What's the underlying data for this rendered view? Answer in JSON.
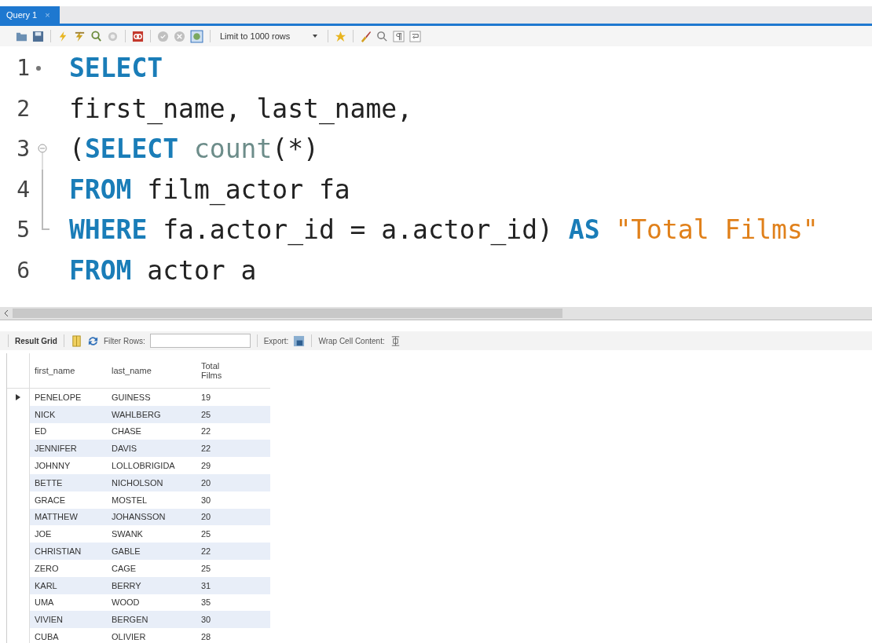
{
  "tabs": [
    {
      "label": "Query 1",
      "close": "×",
      "selected": true
    }
  ],
  "toolbar": {
    "limit_select": "Limit to 1000 rows"
  },
  "editor": {
    "lines": [
      {
        "number": "1",
        "current_line": true,
        "tokens": [
          {
            "kind": "keyword",
            "text": "SELECT"
          }
        ]
      },
      {
        "number": "2",
        "tokens": [
          {
            "kind": "plain",
            "text": "first_name, last_name,"
          }
        ]
      },
      {
        "number": "3",
        "fold_start": true,
        "tokens": [
          {
            "kind": "plain",
            "text": "("
          },
          {
            "kind": "keyword",
            "text": "SELECT"
          },
          {
            "kind": "function",
            "text": "count",
            "space_before": true
          },
          {
            "kind": "plain",
            "text": "(*)"
          }
        ]
      },
      {
        "number": "4",
        "fold_inside": true,
        "tokens": [
          {
            "kind": "keyword",
            "text": "FROM"
          },
          {
            "kind": "plain",
            "text": "film_actor fa",
            "space_before": true
          }
        ]
      },
      {
        "number": "5",
        "fold_end": true,
        "tokens": [
          {
            "kind": "keyword",
            "text": "WHERE"
          },
          {
            "kind": "plain",
            "text": "fa.actor_id = a.actor_id)",
            "space_before": true
          },
          {
            "kind": "keyword",
            "text": "AS",
            "space_before": true
          },
          {
            "kind": "string",
            "text": "\"Total Films\"",
            "space_before": true
          }
        ]
      },
      {
        "number": "6",
        "tokens": [
          {
            "kind": "keyword",
            "text": "FROM"
          },
          {
            "kind": "plain",
            "text": "actor a",
            "space_before": true
          }
        ]
      }
    ]
  },
  "result_toolbar": {
    "result_grid": "Result Grid",
    "filter_label": "Filter Rows:",
    "export_label": "Export:",
    "wrap_label": "Wrap Cell Content:"
  },
  "grid": {
    "columns": [
      "first_name",
      "last_name",
      "Total Films"
    ],
    "rows": [
      {
        "selected": true,
        "cells": [
          "PENELOPE",
          "GUINESS",
          "19"
        ]
      },
      {
        "selected": false,
        "cells": [
          "NICK",
          "WAHLBERG",
          "25"
        ]
      },
      {
        "selected": false,
        "cells": [
          "ED",
          "CHASE",
          "22"
        ]
      },
      {
        "selected": false,
        "cells": [
          "JENNIFER",
          "DAVIS",
          "22"
        ]
      },
      {
        "selected": false,
        "cells": [
          "JOHNNY",
          "LOLLOBRIGIDA",
          "29"
        ]
      },
      {
        "selected": false,
        "cells": [
          "BETTE",
          "NICHOLSON",
          "20"
        ]
      },
      {
        "selected": false,
        "cells": [
          "GRACE",
          "MOSTEL",
          "30"
        ]
      },
      {
        "selected": false,
        "cells": [
          "MATTHEW",
          "JOHANSSON",
          "20"
        ]
      },
      {
        "selected": false,
        "cells": [
          "JOE",
          "SWANK",
          "25"
        ]
      },
      {
        "selected": false,
        "cells": [
          "CHRISTIAN",
          "GABLE",
          "22"
        ]
      },
      {
        "selected": false,
        "cells": [
          "ZERO",
          "CAGE",
          "25"
        ]
      },
      {
        "selected": false,
        "cells": [
          "KARL",
          "BERRY",
          "31"
        ]
      },
      {
        "selected": false,
        "cells": [
          "UMA",
          "WOOD",
          "35"
        ]
      },
      {
        "selected": false,
        "cells": [
          "VIVIEN",
          "BERGEN",
          "30"
        ]
      },
      {
        "selected": false,
        "cells": [
          "CUBA",
          "OLIVIER",
          "28"
        ]
      }
    ]
  }
}
